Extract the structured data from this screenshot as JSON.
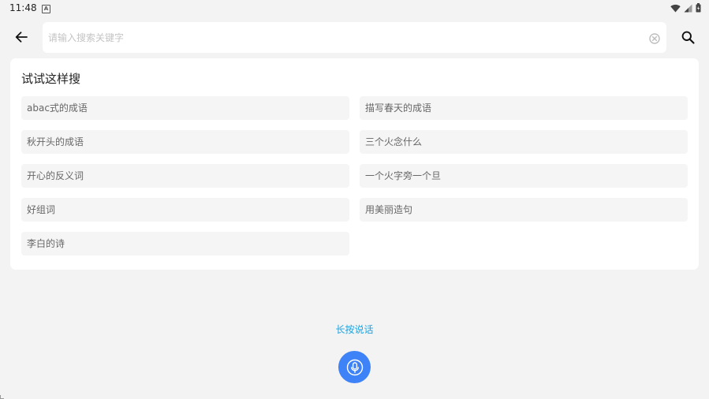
{
  "status_bar": {
    "time": "11:48",
    "notification_icon": "android-badge-icon",
    "icons": [
      "wifi-icon",
      "signal-icon",
      "battery-icon"
    ]
  },
  "search": {
    "placeholder": "请输入搜索关键字",
    "value": ""
  },
  "suggestions": {
    "title": "试试这样搜",
    "items": [
      "abac式的成语",
      "描写春天的成语",
      "秋开头的成语",
      "三个火念什么",
      "开心的反义词",
      "一个火字旁一个旦",
      "好组词",
      "用美丽造句",
      "李白的诗"
    ]
  },
  "voice": {
    "hint": "长按说话"
  },
  "colors": {
    "background": "#f3f3f3",
    "card": "#ffffff",
    "chip": "#f5f5f5",
    "accent_text": "#1fa3e0",
    "mic_button": "#3d82f6"
  }
}
